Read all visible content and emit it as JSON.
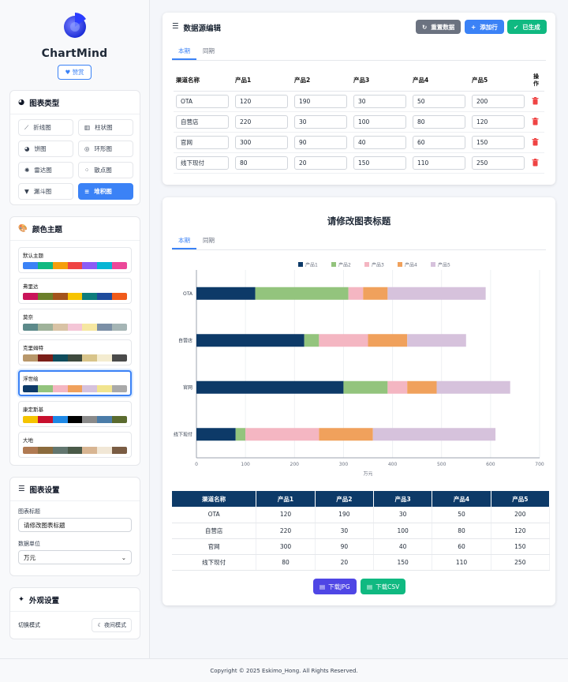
{
  "brand": "ChartMind",
  "like_label": "赞赏",
  "chart_types": {
    "title": "图表类型",
    "items": [
      {
        "label": "折线图",
        "icon": "line-chart-icon",
        "active": false
      },
      {
        "label": "柱状图",
        "icon": "bar-chart-icon",
        "active": false
      },
      {
        "label": "饼图",
        "icon": "pie-chart-icon",
        "active": false
      },
      {
        "label": "环形图",
        "icon": "ring-chart-icon",
        "active": false
      },
      {
        "label": "雷达图",
        "icon": "radar-chart-icon",
        "active": false
      },
      {
        "label": "散点图",
        "icon": "scatter-chart-icon",
        "active": false
      },
      {
        "label": "漏斗图",
        "icon": "funnel-chart-icon",
        "active": false
      },
      {
        "label": "堆积图",
        "icon": "stack-chart-icon",
        "active": true
      }
    ]
  },
  "themes": {
    "title": "颜色主题",
    "items": [
      {
        "name": "默认主题",
        "colors": [
          "#3b82f6",
          "#10b981",
          "#f59e0b",
          "#ef4444",
          "#8b5cf6",
          "#06b6d4",
          "#ec4899"
        ],
        "selected": false
      },
      {
        "name": "弗里达",
        "colors": [
          "#c9145a",
          "#6b7f2a",
          "#a3531c",
          "#f7c400",
          "#0e7d7c",
          "#1e4b9c",
          "#f05a1a"
        ],
        "selected": false
      },
      {
        "name": "莫奈",
        "colors": [
          "#5c8a8a",
          "#9fb29a",
          "#d9c3a5",
          "#f4c6d7",
          "#f6e7a1",
          "#7b8fa6",
          "#a5b5b5"
        ],
        "selected": false
      },
      {
        "name": "克里姆特",
        "colors": [
          "#b8976a",
          "#7a1e18",
          "#0f4c5c",
          "#3e4a3d",
          "#d8c48a",
          "#f4ecd0",
          "#4a4a4a"
        ],
        "selected": false
      },
      {
        "name": "浮世绘",
        "colors": [
          "#0d3a68",
          "#93c47d",
          "#f4b6c2",
          "#f0a15c",
          "#d6c2dc",
          "#f1e48e",
          "#a9a9a9"
        ],
        "selected": true
      },
      {
        "name": "康定斯基",
        "colors": [
          "#f5c400",
          "#c8102e",
          "#1e88e5",
          "#000000",
          "#8a8a8a",
          "#4b7ca8",
          "#5b6b2f"
        ],
        "selected": false
      },
      {
        "name": "大地",
        "colors": [
          "#b07a52",
          "#8b6b3d",
          "#62766f",
          "#4a5a48",
          "#d8b592",
          "#f1e7d6",
          "#7a5c43"
        ],
        "selected": false
      }
    ]
  },
  "settings": {
    "title": "图表设置",
    "title_label": "图表标题",
    "title_value": "请修改图表标题",
    "unit_label": "数据单位",
    "unit_value": "万元"
  },
  "appearance": {
    "title": "外观设置",
    "mode_label": "切换模式",
    "night_btn": "夜间模式"
  },
  "editor": {
    "title": "数据源编辑",
    "reset_btn": "重置数据",
    "add_btn": "添加行",
    "gen_btn": "已生成",
    "tabs": [
      "本期",
      "同期"
    ],
    "headers": [
      "渠道名称",
      "产品1",
      "产品2",
      "产品3",
      "产品4",
      "产品5",
      "操作"
    ],
    "rows": [
      [
        "OTA",
        "120",
        "190",
        "30",
        "50",
        "200"
      ],
      [
        "自营店",
        "220",
        "30",
        "100",
        "80",
        "120"
      ],
      [
        "官网",
        "300",
        "90",
        "40",
        "60",
        "150"
      ],
      [
        "线下现付",
        "80",
        "20",
        "150",
        "110",
        "250"
      ]
    ]
  },
  "chart": {
    "tabs": [
      "本期",
      "同期"
    ],
    "download_jpg": "下载JPG",
    "download_csv": "下载CSV"
  },
  "chart_data": {
    "type": "bar",
    "orientation": "horizontal",
    "stacked": true,
    "title": "请修改图表标题",
    "categories": [
      "OTA",
      "自营店",
      "官网",
      "线下现付"
    ],
    "series": [
      {
        "name": "产品1",
        "values": [
          120,
          220,
          300,
          80
        ],
        "color": "#0d3a68"
      },
      {
        "name": "产品2",
        "values": [
          190,
          30,
          90,
          20
        ],
        "color": "#93c47d"
      },
      {
        "name": "产品3",
        "values": [
          30,
          100,
          40,
          150
        ],
        "color": "#f4b6c2"
      },
      {
        "name": "产品4",
        "values": [
          50,
          80,
          60,
          110
        ],
        "color": "#f0a15c"
      },
      {
        "name": "产品5",
        "values": [
          200,
          120,
          150,
          250
        ],
        "color": "#d6c2dc"
      }
    ],
    "xlim": [
      0,
      700
    ],
    "xticks": [
      0,
      100,
      200,
      300,
      400,
      500,
      600,
      700
    ],
    "xlabel": "万元",
    "legend": "top",
    "grid": true
  },
  "table": {
    "headers": [
      "渠道名称",
      "产品1",
      "产品2",
      "产品3",
      "产品4",
      "产品5"
    ],
    "rows": [
      [
        "OTA",
        "120",
        "190",
        "30",
        "50",
        "200"
      ],
      [
        "自营店",
        "220",
        "30",
        "100",
        "80",
        "120"
      ],
      [
        "官网",
        "300",
        "90",
        "40",
        "60",
        "150"
      ],
      [
        "线下现付",
        "80",
        "20",
        "150",
        "110",
        "250"
      ]
    ]
  },
  "footer": "Copyright © 2025 Eskimo_Hong. All Rights Reserved."
}
